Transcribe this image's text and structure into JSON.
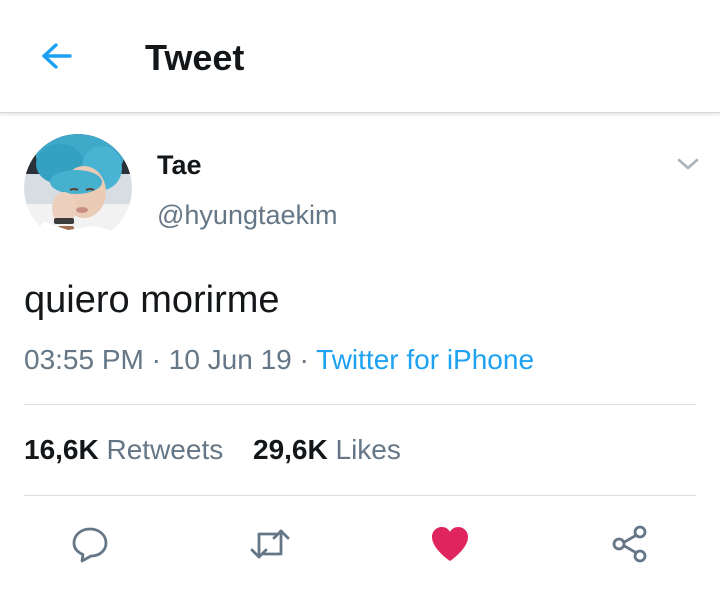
{
  "header": {
    "title": "Tweet",
    "back_icon": "arrow-left-icon",
    "accent_color": "#1da1f2"
  },
  "tweet": {
    "author": {
      "name": "Tae",
      "handle": "@hyungtaekim",
      "avatar": "profile-photo"
    },
    "text": "quiero morirme",
    "time": "03:55 PM",
    "date": "10 Jun 19",
    "separator": "·",
    "source": "Twitter for iPhone",
    "stats": {
      "retweets_count": "16,6K",
      "retweets_label": "Retweets",
      "likes_count": "29,6K",
      "likes_label": "Likes"
    },
    "liked": true,
    "like_color": "#e0245e"
  },
  "actions": [
    "reply",
    "retweet",
    "like",
    "share"
  ]
}
